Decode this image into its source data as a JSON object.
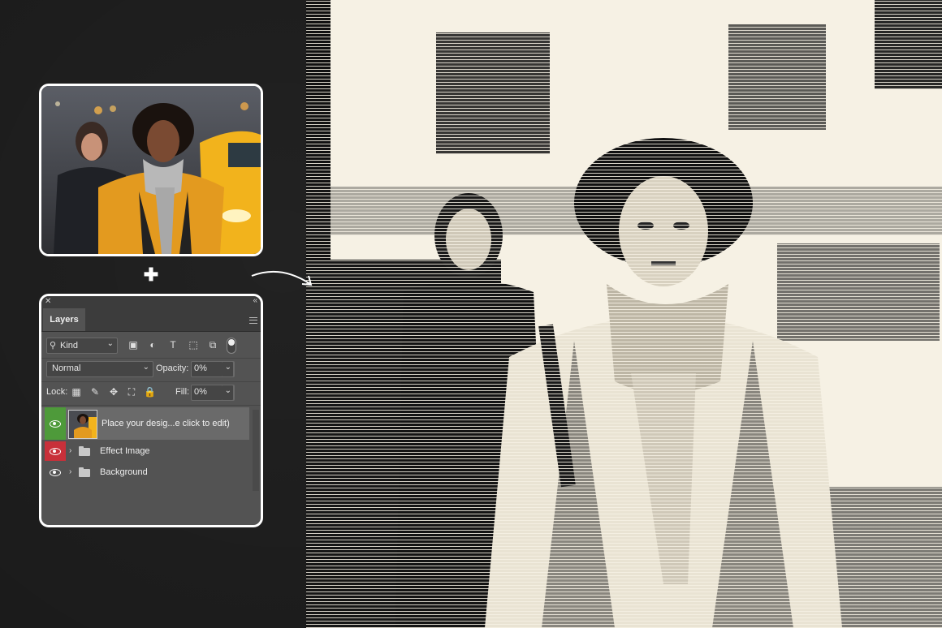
{
  "layers_panel": {
    "tab_label": "Layers",
    "filter_kind": "Kind",
    "blend_mode": "Normal",
    "opacity_label": "Opacity:",
    "opacity_value": "0%",
    "lock_label": "Lock:",
    "fill_label": "Fill:",
    "fill_value": "0%",
    "layers": [
      {
        "name": "Place your desig...e click to edit)",
        "eye_color": "#4e9a3a",
        "selected": true
      },
      {
        "name": "Effect Image",
        "eye_color": "#c8303a",
        "selected": false
      },
      {
        "name": "Background",
        "eye_color": "#535353",
        "selected": false
      }
    ]
  },
  "plus_symbol": "✚",
  "icons": [
    "close-icon",
    "collapse-icon",
    "panel-menu-icon",
    "search-icon",
    "chevron-down-icon",
    "image-filter-icon",
    "adjustment-filter-icon",
    "type-filter-icon",
    "shape-filter-icon",
    "smart-object-filter-icon",
    "filter-toggle-icon",
    "lock-pixels-icon",
    "lock-paint-icon",
    "lock-move-icon",
    "lock-artboard-icon",
    "lock-all-icon",
    "eye-icon",
    "folder-icon",
    "expand-caret-icon",
    "arrow-icon"
  ],
  "colors": {
    "background": "#1b1b1b",
    "panel": "#535353",
    "effect_paper": "#f6f1e4",
    "ink": "#111111"
  }
}
